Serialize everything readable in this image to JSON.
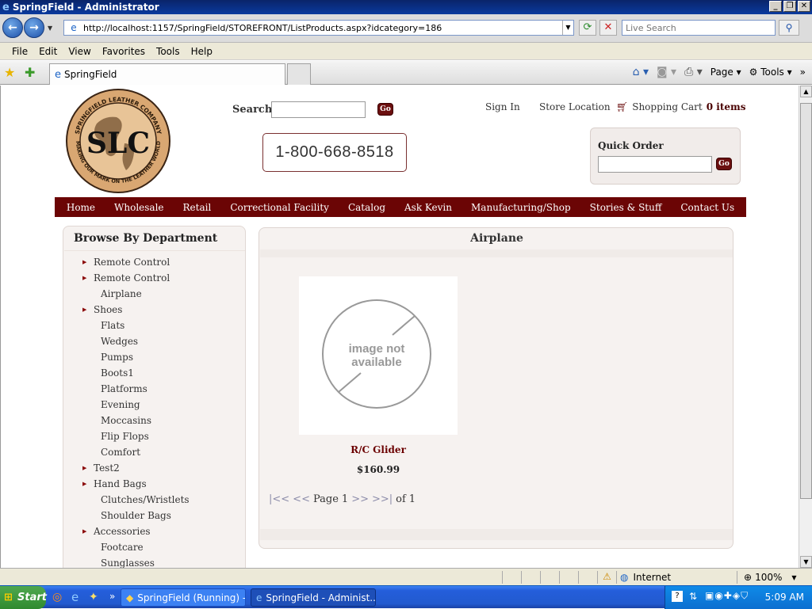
{
  "window": {
    "title": "SpringField - Administrator"
  },
  "browser": {
    "url": "http://localhost:1157/SpringField/STOREFRONT/ListProducts.aspx?idcategory=186",
    "search_placeholder": "Live Search",
    "menu": [
      "File",
      "Edit",
      "View",
      "Favorites",
      "Tools",
      "Help"
    ],
    "tab_title": "SpringField",
    "cmd_page": "Page",
    "cmd_tools": "Tools"
  },
  "site": {
    "logo_text": "SLC",
    "logo_ring_top": "SPRINGFIELD LEATHER COMPANY",
    "logo_ring_bottom": "MAKING OUR MARK ON THE LEATHER WORLD",
    "search_label": "Search",
    "go_label": "Go",
    "phone": "1-800-668-8518",
    "sign_in": "Sign In",
    "store_location": "Store Location",
    "cart_label": "Shopping Cart",
    "cart_count": "0 items",
    "quick_order_label": "Quick Order",
    "nav": [
      "Home",
      "Wholesale",
      "Retail",
      "Correctional Facility",
      "Catalog",
      "Ask Kevin",
      "Manufacturing/Shop",
      "Stories & Stuff",
      "Contact Us"
    ]
  },
  "sidebar": {
    "title": "Browse By Department",
    "items": [
      {
        "label": "Remote Control",
        "level": 0
      },
      {
        "label": "Remote Control",
        "level": 0
      },
      {
        "label": "Airplane",
        "level": 1
      },
      {
        "label": "Shoes",
        "level": 0
      },
      {
        "label": "Flats",
        "level": 1
      },
      {
        "label": "Wedges",
        "level": 1
      },
      {
        "label": "Pumps",
        "level": 1
      },
      {
        "label": "Boots1",
        "level": 1
      },
      {
        "label": "Platforms",
        "level": 1
      },
      {
        "label": "Evening",
        "level": 1
      },
      {
        "label": "Moccasins",
        "level": 1
      },
      {
        "label": "Flip Flops",
        "level": 1
      },
      {
        "label": "Comfort",
        "level": 1
      },
      {
        "label": "Test2",
        "level": 0
      },
      {
        "label": "Hand Bags",
        "level": 0
      },
      {
        "label": "Clutches/Wristlets",
        "level": 1
      },
      {
        "label": "Shoulder Bags",
        "level": 1
      },
      {
        "label": "Accessories",
        "level": 0
      },
      {
        "label": "Footcare",
        "level": 1
      },
      {
        "label": "Sunglasses",
        "level": 1
      }
    ]
  },
  "main": {
    "category_title": "Airplane",
    "product": {
      "image_text_line1": "image not",
      "image_text_line2": "available",
      "name": "R/C Glider",
      "price": "$160.99"
    },
    "pager": {
      "first": "|<<",
      "prev": "<<",
      "page_label": "Page",
      "page": "1",
      "next": ">>",
      "last": ">>|",
      "of_label": "of",
      "total": "1"
    }
  },
  "statusbar": {
    "zone": "Internet",
    "zoom": "100%"
  },
  "taskbar": {
    "start": "Start",
    "buttons": [
      "SpringField (Running) - M...",
      "SpringField - Administ..."
    ],
    "clock": "5:09 AM"
  },
  "colors": {
    "brand": "#6b0505",
    "panel": "#f6f2f0",
    "xp_blue": "#245edb"
  }
}
